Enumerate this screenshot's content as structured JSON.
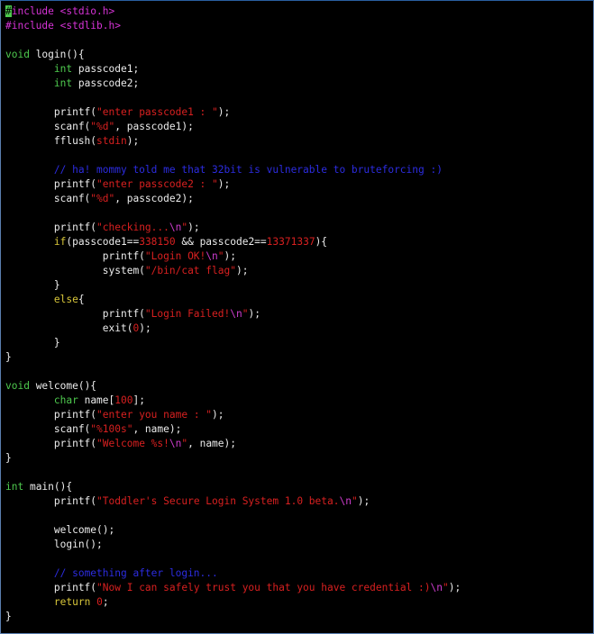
{
  "editor": {
    "lines": [
      [
        [
          "pre",
          "#include <stdio.h>"
        ]
      ],
      [
        [
          "pre",
          "#include <stdlib.h>"
        ]
      ],
      [],
      [
        [
          "type",
          "void"
        ],
        [
          "txt",
          " login(){"
        ]
      ],
      [
        [
          "txt",
          "        "
        ],
        [
          "type",
          "int"
        ],
        [
          "txt",
          " passcode1;"
        ]
      ],
      [
        [
          "txt",
          "        "
        ],
        [
          "type",
          "int"
        ],
        [
          "txt",
          " passcode2;"
        ]
      ],
      [],
      [
        [
          "txt",
          "        printf("
        ],
        [
          "str",
          "\"enter passcode1 : \""
        ],
        [
          "txt",
          ");"
        ]
      ],
      [
        [
          "txt",
          "        scanf("
        ],
        [
          "str",
          "\"%d\""
        ],
        [
          "txt",
          ", passcode1);"
        ]
      ],
      [
        [
          "txt",
          "        fflush("
        ],
        [
          "str",
          "stdin"
        ],
        [
          "txt",
          ");"
        ]
      ],
      [],
      [
        [
          "txt",
          "        "
        ],
        [
          "com",
          "// ha! mommy told me that 32bit is vulnerable to bruteforcing :)"
        ]
      ],
      [
        [
          "txt",
          "        printf("
        ],
        [
          "str",
          "\"enter passcode2 : \""
        ],
        [
          "txt",
          ");"
        ]
      ],
      [
        [
          "txt",
          "        scanf("
        ],
        [
          "str",
          "\"%d\""
        ],
        [
          "txt",
          ", passcode2);"
        ]
      ],
      [],
      [
        [
          "txt",
          "        printf("
        ],
        [
          "str",
          "\"checking..."
        ],
        [
          "esc",
          "\\n"
        ],
        [
          "str",
          "\""
        ],
        [
          "txt",
          ");"
        ]
      ],
      [
        [
          "txt",
          "        "
        ],
        [
          "kw",
          "if"
        ],
        [
          "txt",
          "(passcode1=="
        ],
        [
          "num",
          "338150"
        ],
        [
          "txt",
          " && passcode2=="
        ],
        [
          "num",
          "13371337"
        ],
        [
          "txt",
          "){"
        ]
      ],
      [
        [
          "txt",
          "                printf("
        ],
        [
          "str",
          "\"Login OK!"
        ],
        [
          "esc",
          "\\n"
        ],
        [
          "str",
          "\""
        ],
        [
          "txt",
          ");"
        ]
      ],
      [
        [
          "txt",
          "                system("
        ],
        [
          "str",
          "\"/bin/cat flag\""
        ],
        [
          "txt",
          ");"
        ]
      ],
      [
        [
          "txt",
          "        }"
        ]
      ],
      [
        [
          "txt",
          "        "
        ],
        [
          "kw",
          "else"
        ],
        [
          "txt",
          "{"
        ]
      ],
      [
        [
          "txt",
          "                printf("
        ],
        [
          "str",
          "\"Login Failed!"
        ],
        [
          "esc",
          "\\n"
        ],
        [
          "str",
          "\""
        ],
        [
          "txt",
          ");"
        ]
      ],
      [
        [
          "txt",
          "                exit("
        ],
        [
          "num",
          "0"
        ],
        [
          "txt",
          ");"
        ]
      ],
      [
        [
          "txt",
          "        }"
        ]
      ],
      [
        [
          "txt",
          "}"
        ]
      ],
      [],
      [
        [
          "type",
          "void"
        ],
        [
          "txt",
          " welcome(){"
        ]
      ],
      [
        [
          "txt",
          "        "
        ],
        [
          "type",
          "char"
        ],
        [
          "txt",
          " name["
        ],
        [
          "num",
          "100"
        ],
        [
          "txt",
          "];"
        ]
      ],
      [
        [
          "txt",
          "        printf("
        ],
        [
          "str",
          "\"enter you name : \""
        ],
        [
          "txt",
          ");"
        ]
      ],
      [
        [
          "txt",
          "        scanf("
        ],
        [
          "str",
          "\"%100s\""
        ],
        [
          "txt",
          ", name);"
        ]
      ],
      [
        [
          "txt",
          "        printf("
        ],
        [
          "str",
          "\"Welcome %s!"
        ],
        [
          "esc",
          "\\n"
        ],
        [
          "str",
          "\""
        ],
        [
          "txt",
          ", name);"
        ]
      ],
      [
        [
          "txt",
          "}"
        ]
      ],
      [],
      [
        [
          "type",
          "int"
        ],
        [
          "txt",
          " main(){"
        ]
      ],
      [
        [
          "txt",
          "        printf("
        ],
        [
          "str",
          "\"Toddler's Secure Login System 1.0 beta."
        ],
        [
          "esc",
          "\\n"
        ],
        [
          "str",
          "\""
        ],
        [
          "txt",
          ");"
        ]
      ],
      [],
      [
        [
          "txt",
          "        welcome();"
        ]
      ],
      [
        [
          "txt",
          "        login();"
        ]
      ],
      [],
      [
        [
          "txt",
          "        "
        ],
        [
          "com",
          "// something after login..."
        ]
      ],
      [
        [
          "txt",
          "        printf("
        ],
        [
          "str",
          "\"Now I can safely trust you that you have credential :)"
        ],
        [
          "esc",
          "\\n"
        ],
        [
          "str",
          "\""
        ],
        [
          "txt",
          ");"
        ]
      ],
      [
        [
          "txt",
          "        "
        ],
        [
          "kw",
          "return"
        ],
        [
          "txt",
          " "
        ],
        [
          "num",
          "0"
        ],
        [
          "txt",
          ";"
        ]
      ],
      [
        [
          "txt",
          "}"
        ]
      ]
    ]
  },
  "colors": {
    "background": "#000000",
    "preprocessor": "#d633d6",
    "type": "#4ec94e",
    "keyword": "#d8c63a",
    "string": "#d82020",
    "escape": "#cc3ccc",
    "number": "#d82020",
    "comment": "#2c2ce0",
    "text": "#ececec",
    "cursor": "#4ec94e"
  }
}
